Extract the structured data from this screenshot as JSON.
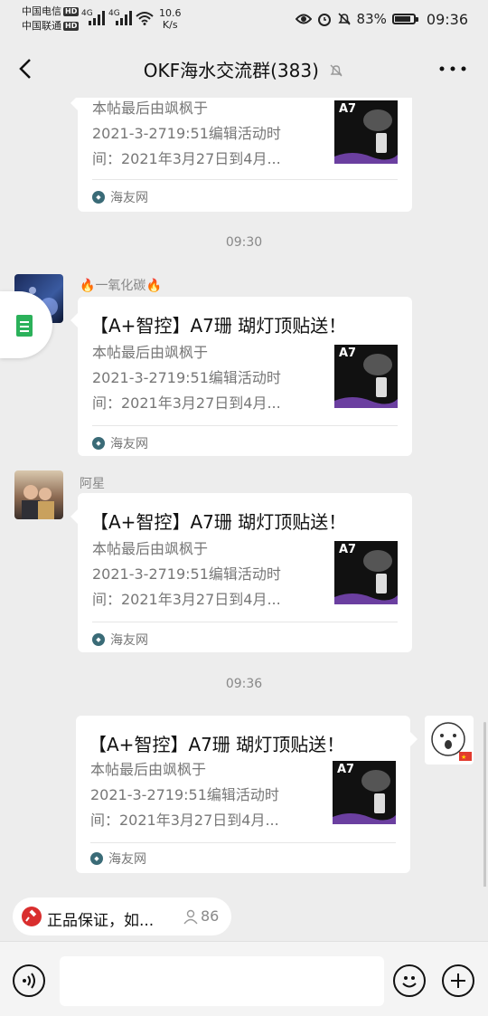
{
  "status_bar": {
    "carrier1": "中国电信",
    "carrier2": "中国联通",
    "hd": "HD",
    "net1": "4G",
    "net2": "4G",
    "speed_value": "10.6",
    "speed_unit": "K/s",
    "battery": "83%",
    "time": "09:36"
  },
  "header": {
    "title": "OKF海水交流群(383)"
  },
  "floating_tab": {
    "icon": "document-icon"
  },
  "timestamps": [
    "09:30",
    "09:36"
  ],
  "messages": [
    {
      "sender": "",
      "title": "",
      "desc": [
        "本帖最后由飒枫于",
        "2021-3-2719:51编辑活动时",
        "间：2021年3月27日到4月..."
      ],
      "source": "海友网",
      "thumb_label": "A7"
    },
    {
      "sender_prefix": "🔥",
      "sender": "一氧化碳",
      "sender_suffix": "🔥",
      "title": "【A+智控】A7珊 瑚灯顶贴送！",
      "desc": [
        "本帖最后由飒枫于",
        "2021-3-2719:51编辑活动时",
        "间：2021年3月27日到4月..."
      ],
      "source": "海友网",
      "thumb_label": "A7"
    },
    {
      "sender": "阿星",
      "title": "【A+智控】A7珊 瑚灯顶贴送！",
      "desc": [
        "本帖最后由飒枫于",
        "2021-3-2719:51编辑活动时",
        "间：2021年3月27日到4月..."
      ],
      "source": "海友网",
      "thumb_label": "A7"
    },
    {
      "sender": "",
      "title": "【A+智控】A7珊 瑚灯顶贴送！",
      "desc": [
        "本帖最后由飒枫于",
        "2021-3-2719:51编辑活动时",
        "间：2021年3月27日到4月..."
      ],
      "source": "海友网",
      "thumb_label": "A7"
    }
  ],
  "notice": {
    "text": "正品保证，如...",
    "count": "86"
  },
  "colors": {
    "background": "#ededed",
    "card": "#ffffff",
    "accent_green": "#2bb15a",
    "notice_red": "#d92e2e"
  }
}
